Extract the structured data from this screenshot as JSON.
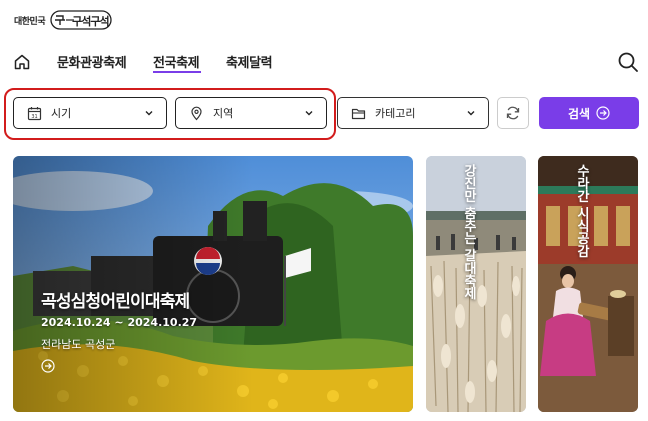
{
  "logo": {
    "gov_text": "대한민국",
    "brand_text": "구석구석"
  },
  "nav": {
    "items": [
      {
        "label": "문화관광축제",
        "active": false
      },
      {
        "label": "전국축제",
        "active": true
      },
      {
        "label": "축제달력",
        "active": false
      }
    ]
  },
  "filters": {
    "time": {
      "label": "시기",
      "icon": "calendar-icon"
    },
    "region": {
      "label": "지역",
      "icon": "location-pin-icon"
    },
    "category": {
      "label": "카테고리",
      "icon": "folder-icon"
    }
  },
  "search_button": {
    "label": "검색",
    "icon": "arrow-right-circle-icon"
  },
  "colors": {
    "accent": "#7a3de8",
    "highlight": "#d21c1c"
  },
  "cards": {
    "main": {
      "title": "곡성심청어린이대축제",
      "dates": "2024.10.24 ~ 2024.10.27",
      "location": "전라남도 곡성군"
    },
    "second": {
      "title": "강진만 춤추는 갈대축제"
    },
    "third": {
      "title": "수라간 시식공감"
    }
  }
}
